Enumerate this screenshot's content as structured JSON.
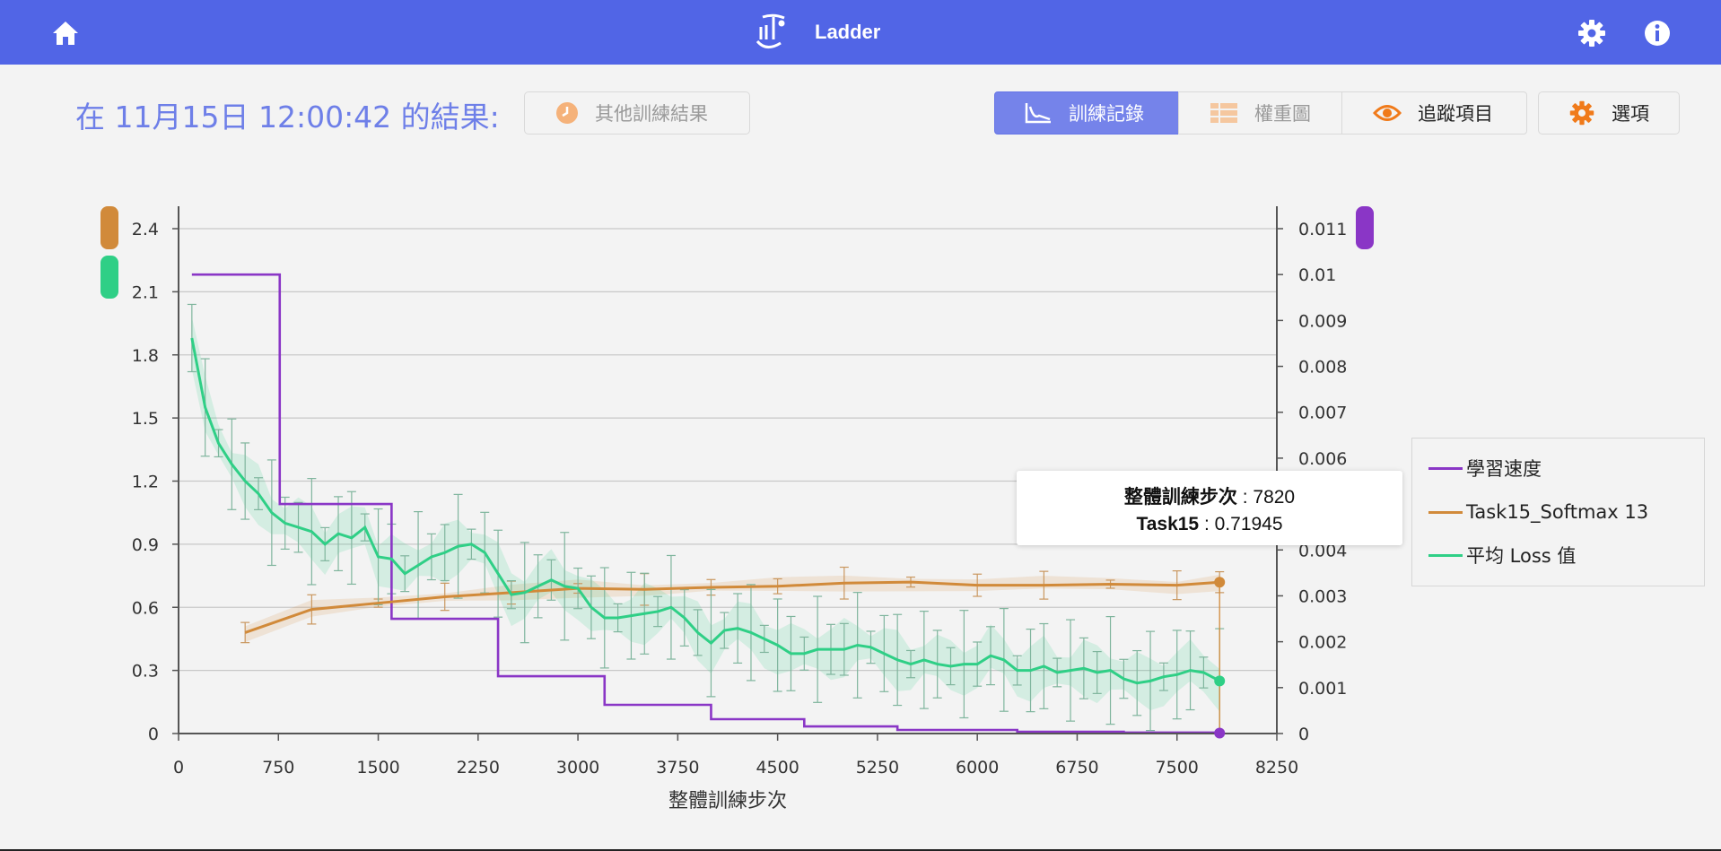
{
  "app": {
    "title": "Ladder"
  },
  "icons": {
    "home": "home-icon",
    "logo": "ladder-logo",
    "settings": "gear-icon",
    "info": "info-icon"
  },
  "header": {
    "result_title": "在 11月15日 12:00:42 的結果:",
    "other_results_label": "其他訓練結果"
  },
  "toolbar": {
    "log_label": "訓練記錄",
    "weights_label": "權重圖",
    "tracking_label": "追蹤項目",
    "options_label": "選項"
  },
  "colors": {
    "accent": "#5165e6",
    "purple": "#8a36c6",
    "orange": "#d18a3a",
    "green": "#2fcf86"
  },
  "chart_data": {
    "type": "line",
    "xlabel": "整體訓練步次",
    "xlim": [
      0,
      8250
    ],
    "x_ticks": [
      "0",
      "750",
      "1500",
      "2250",
      "3000",
      "3750",
      "4500",
      "5250",
      "6000",
      "6750",
      "7500",
      "8250"
    ],
    "ylim_left": [
      0,
      2.4
    ],
    "y_ticks_left": [
      "0",
      "0.3",
      "0.6",
      "0.9",
      "1.2",
      "1.5",
      "1.8",
      "2.1",
      "2.4"
    ],
    "ylim_right": [
      0,
      0.011
    ],
    "y_ticks_right": [
      "0",
      "0.001",
      "0.002",
      "0.003",
      "0.004",
      "0.005",
      "0.006",
      "0.007",
      "0.008",
      "0.009",
      "0.01",
      "0.011"
    ],
    "grid": true,
    "legend_position": "right",
    "series": [
      {
        "name": "學習速度",
        "axis": "right",
        "step": true,
        "x": [
          100,
          760,
          1600,
          2400,
          3200,
          4000,
          4700,
          5400,
          6300,
          7100,
          7820
        ],
        "values": [
          0.01,
          0.005,
          0.0025,
          0.00125,
          0.000625,
          0.0003125,
          0.000156,
          7.8e-05,
          3.9e-05,
          2e-05,
          1e-05
        ]
      },
      {
        "name": "Task15_Softmax 13",
        "axis": "left",
        "x": [
          500,
          1000,
          1500,
          2000,
          2500,
          3000,
          3500,
          4000,
          4500,
          5000,
          5500,
          6000,
          6500,
          7000,
          7500,
          7820
        ],
        "values": [
          0.48,
          0.59,
          0.62,
          0.65,
          0.67,
          0.69,
          0.685,
          0.695,
          0.7,
          0.715,
          0.72,
          0.705,
          0.705,
          0.71,
          0.705,
          0.71945
        ]
      },
      {
        "name": "平均 Loss 值",
        "axis": "left",
        "x": [
          100,
          200,
          300,
          400,
          500,
          600,
          700,
          800,
          900,
          1000,
          1100,
          1200,
          1300,
          1400,
          1500,
          1600,
          1700,
          1800,
          1900,
          2000,
          2100,
          2200,
          2300,
          2400,
          2500,
          2600,
          2700,
          2800,
          2900,
          3000,
          3100,
          3200,
          3300,
          3400,
          3500,
          3600,
          3700,
          3800,
          3900,
          4000,
          4100,
          4200,
          4300,
          4400,
          4500,
          4600,
          4700,
          4800,
          4900,
          5000,
          5100,
          5200,
          5300,
          5400,
          5500,
          5600,
          5700,
          5800,
          5900,
          6000,
          6100,
          6200,
          6300,
          6400,
          6500,
          6600,
          6700,
          6800,
          6900,
          7000,
          7100,
          7200,
          7300,
          7400,
          7500,
          7600,
          7700,
          7820
        ],
        "values": [
          1.88,
          1.55,
          1.38,
          1.28,
          1.2,
          1.14,
          1.05,
          1.0,
          0.98,
          0.96,
          0.9,
          0.95,
          0.93,
          0.98,
          0.84,
          0.83,
          0.76,
          0.8,
          0.84,
          0.86,
          0.89,
          0.9,
          0.86,
          0.76,
          0.66,
          0.67,
          0.7,
          0.73,
          0.7,
          0.69,
          0.6,
          0.55,
          0.55,
          0.56,
          0.57,
          0.58,
          0.6,
          0.55,
          0.48,
          0.43,
          0.49,
          0.5,
          0.48,
          0.45,
          0.42,
          0.38,
          0.38,
          0.4,
          0.4,
          0.4,
          0.42,
          0.41,
          0.38,
          0.35,
          0.33,
          0.35,
          0.33,
          0.32,
          0.33,
          0.33,
          0.37,
          0.35,
          0.3,
          0.3,
          0.32,
          0.29,
          0.3,
          0.31,
          0.29,
          0.3,
          0.26,
          0.24,
          0.25,
          0.27,
          0.28,
          0.3,
          0.29,
          0.25
        ]
      }
    ],
    "tooltip": {
      "x_label": "整體訓練步次",
      "x_value": "7820",
      "series_label": "Task15",
      "series_value": "0.71945"
    }
  }
}
